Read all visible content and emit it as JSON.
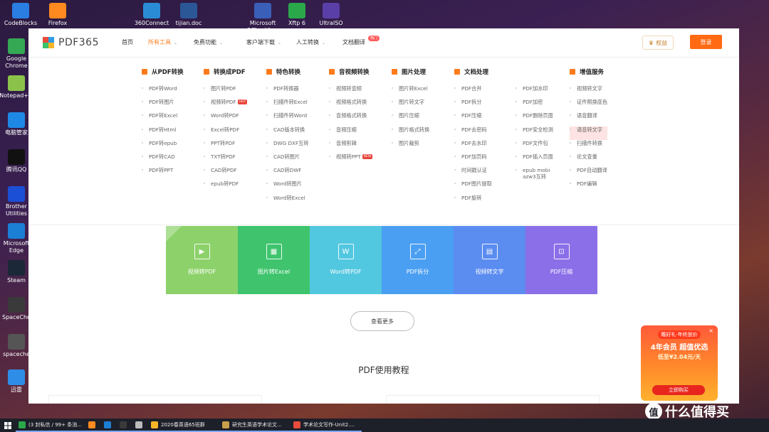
{
  "desktop": {
    "icons_top": [
      {
        "label": "CodeBlocks",
        "color": "#2a7de1"
      },
      {
        "label": "Firefox",
        "color": "#ff8a1f"
      },
      {
        "label": "360Connect",
        "color": "#2b8cd6"
      },
      {
        "label": "tijian.doc",
        "color": "#2b5797"
      },
      {
        "label": "Microsoft Office Vis...",
        "color": "#3a5fb8"
      },
      {
        "label": "Xftp 6",
        "color": "#2aa84a"
      },
      {
        "label": "UltraISO",
        "color": "#5a3fa8"
      }
    ],
    "icons_left": [
      {
        "label": "Google Chrome",
        "color": "#34a853"
      },
      {
        "label": "Notepad++",
        "color": "#8bc34a"
      },
      {
        "label": "电脑管家",
        "color": "#1e88e5"
      },
      {
        "label": "腾讯QQ",
        "color": "#111111"
      },
      {
        "label": "Brother Utilities",
        "color": "#1a4fd6"
      },
      {
        "label": "Microsoft Edge",
        "color": "#1b7fd6"
      },
      {
        "label": "Steam",
        "color": "#1b2838"
      },
      {
        "label": "SpaceChe",
        "color": "#3a3a3a"
      },
      {
        "label": "spaceche",
        "color": "#555555"
      },
      {
        "label": "迅雷",
        "color": "#2e8de6"
      }
    ]
  },
  "site": {
    "logo_text": "PDF365",
    "logo_colors": [
      "#e94b3c",
      "#2f9de4",
      "#3ac26b",
      "#f7b527"
    ],
    "nav": [
      {
        "label": "首页",
        "active": false,
        "caret": false
      },
      {
        "label": "所有工具",
        "active": true,
        "caret": true
      },
      {
        "label": "免费功能",
        "active": false,
        "caret": true
      },
      {
        "label": "客户端下载",
        "active": false,
        "caret": true
      },
      {
        "label": "人工转换",
        "active": false,
        "caret": true
      },
      {
        "label": "文档翻译",
        "active": false,
        "caret": false
      }
    ],
    "nav_hot_badge": "热门",
    "quanyi_label": "权益",
    "login_label": "登录",
    "accent": "#ff6a13"
  },
  "menu": {
    "columns": [
      {
        "head": "从PDF转换",
        "items": [
          "PDF转Word",
          "PDF转图片",
          "PDF转Excel",
          "PDF转Html",
          "PDF转epub",
          "PDF转CAD",
          "PDF转PPT"
        ]
      },
      {
        "head": "转换成PDF",
        "items": [
          "图片转PDF",
          "视频转PDF",
          "Word转PDF",
          "Excel转PDF",
          "PPT转PDF",
          "TXT转PDF",
          "CAD转PDF",
          "epub转PDF"
        ]
      },
      {
        "head": "特色转换",
        "items": [
          "PDF转换器",
          "扫描件转Excel",
          "扫描件转Word",
          "CAD版本转换",
          "DWG DXF互转",
          "CAD转图片",
          "CAD转DWF",
          "Word转图片",
          "Word转Excel"
        ]
      },
      {
        "head": "音视频转换",
        "items": [
          "视频转音频",
          "视频格式转换",
          "音频格式转换",
          "音频压缩",
          "音频剪辑",
          "视频转PPT"
        ]
      },
      {
        "head": "图片处理",
        "items": [
          "图片转Excel",
          "图片转文字",
          "图片压缩",
          "图片格式转换",
          "图片裁剪"
        ]
      },
      {
        "head": "文档处理",
        "items": [
          "PDF合并",
          "PDF拆分",
          "PDF压缩",
          "PDF去密码",
          "PDF去水印",
          "PDF加页码",
          "时间戳认证",
          "PDF图片提取",
          "PDF旋转"
        ]
      },
      {
        "head": "",
        "items": [
          "PDF加水印",
          "PDF加密",
          "PDF删除页面",
          "PDF安全检测",
          "PDF文件包",
          "PDF插入页面",
          "epub mobi azw3互转"
        ]
      },
      {
        "head": "增值服务",
        "items": [
          "视频转文字",
          "证件照换底色",
          "语音翻译",
          "语音转文字",
          "扫描件转换",
          "论文查重",
          "PDF自动翻译",
          "PDF编辑"
        ]
      }
    ],
    "tag_hot": "HOT",
    "tag_new": "NEW"
  },
  "tiles": [
    {
      "label": "视频转PDF",
      "color": "#8dd16a",
      "icon": "▶"
    },
    {
      "label": "图片转Excel",
      "color": "#3fc46d",
      "icon": "▦"
    },
    {
      "label": "Word转PDF",
      "color": "#52c7e0",
      "icon": "W"
    },
    {
      "label": "PDF拆分",
      "color": "#4a9ff2",
      "icon": "⤢"
    },
    {
      "label": "视频转文字",
      "color": "#5b8cf0",
      "icon": "▤"
    },
    {
      "label": "PDF压缩",
      "color": "#8a6fe8",
      "icon": "⊡"
    }
  ],
  "more_label": "查看更多",
  "tutorial_title": "PDF使用教程",
  "promo": {
    "line1": "瞻好礼·年终放价",
    "line2": "4年会员 超值优选",
    "line3": "低至¥2.04元/天",
    "button": "立即购买",
    "close": "×"
  },
  "taskbar": {
    "apps": [
      {
        "label": "(3 封私信 / 99+ 条消...",
        "color": "#2aa84a"
      },
      {
        "label": "",
        "color": "#ff8a1f"
      },
      {
        "label": "",
        "color": "#1b7fd6"
      },
      {
        "label": "",
        "color": "#3a3a3a"
      },
      {
        "label": "",
        "color": "#bbbbbb"
      },
      {
        "label": "2020春英语65班群",
        "color": "#f7b527"
      },
      {
        "label": "研究生英语学术论文...",
        "color": "#c8a04a"
      },
      {
        "label": "学术论文写作-Unit2....",
        "color": "#e94b3c"
      }
    ]
  },
  "watermark": {
    "mark": "值",
    "text": "什么值得买"
  }
}
